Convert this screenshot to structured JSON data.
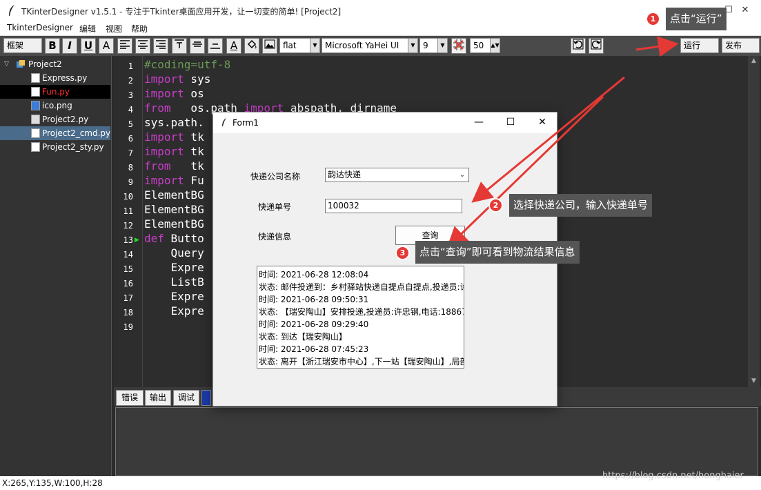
{
  "window": {
    "title": "TKinterDesigner v1.5.1 - 专注于Tkinter桌面应用开发，让一切变的简单!   [Project2]"
  },
  "menu": [
    "TkinterDesigner",
    "编辑",
    "视图",
    "帮助"
  ],
  "toolbar": {
    "frame_select": "框架",
    "style_select": "flat",
    "font_select": "Microsoft YaHei UI",
    "size_select": "9",
    "grid_value": "50",
    "run_label": "运行",
    "publish_label": "发布"
  },
  "tree": {
    "project": "Project2",
    "files": [
      "Express.py",
      "Fun.py",
      "ico.png",
      "Project2.py",
      "Project2_cmd.py",
      "Project2_sty.py"
    ]
  },
  "editor": {
    "line_numbers": [
      "1",
      "2",
      "3",
      "4",
      "5",
      "6",
      "7",
      "8",
      "9",
      "10",
      "11",
      "12",
      "13",
      "14",
      "15",
      "16",
      "17",
      "18",
      "19"
    ],
    "lines": {
      "l1_comment": "#coding=utf-8",
      "import_kw": "import",
      "from_kw": "from",
      "def_kw": "def",
      "l2_rest": " sys",
      "l3_rest": " os",
      "l4_a": "   os.path ",
      "l4_b": " abspath, dirname",
      "l5": "sys.path.",
      "l6_rest": " tk",
      "l7_rest": " tk",
      "l8_rest": "   tk",
      "l9_rest": " Fu",
      "l10": "ElementBG",
      "l11": "ElementBG",
      "l12": "ElementBG",
      "l13_rest": " Butto",
      "l14": "    Query",
      "l15": "    Expre",
      "l16": "    ListB",
      "l17": "    Expre",
      "l18": "    Expre"
    }
  },
  "bottom_tabs": [
    "错误",
    "输出",
    "调试"
  ],
  "status": "X:265,Y:135,W:100,H:28",
  "watermark": "https://blog.csdn.net/honghaier",
  "form1": {
    "title": "Form1",
    "company_label": "快递公司名称",
    "company_value": "韵达快递",
    "tracking_label": "快递单号",
    "tracking_value": "100032",
    "info_label": "快递信息",
    "query_label": "查询",
    "results": [
      "时间: 2021-06-28 12:08:04",
      "状态: 邮件投递到：乡村驿站快递自提点自提点,投递员:许",
      "时间: 2021-06-28 09:50:31",
      "状态: 【瑞安陶山】安排投递,投递员:许忠钢,电话:18867",
      "时间: 2021-06-28 09:29:40",
      "状态: 到达【瑞安陶山】",
      "时间: 2021-06-28 07:45:23",
      "状态: 离开【浙江瑞安市中心】,下一站【瑞安陶山】,局部"
    ]
  },
  "annotations": [
    {
      "num": "1",
      "text": "点击“运行”"
    },
    {
      "num": "2",
      "text": "选择快递公司，输入快递单号"
    },
    {
      "num": "3",
      "text": "点击“查询”即可看到物流结果信息"
    }
  ],
  "colors": {
    "keyword": "#c83ec8",
    "comment": "#6a9955",
    "badge": "#e53935",
    "arrow": "#e53935",
    "selected_file": "#ff3030"
  }
}
